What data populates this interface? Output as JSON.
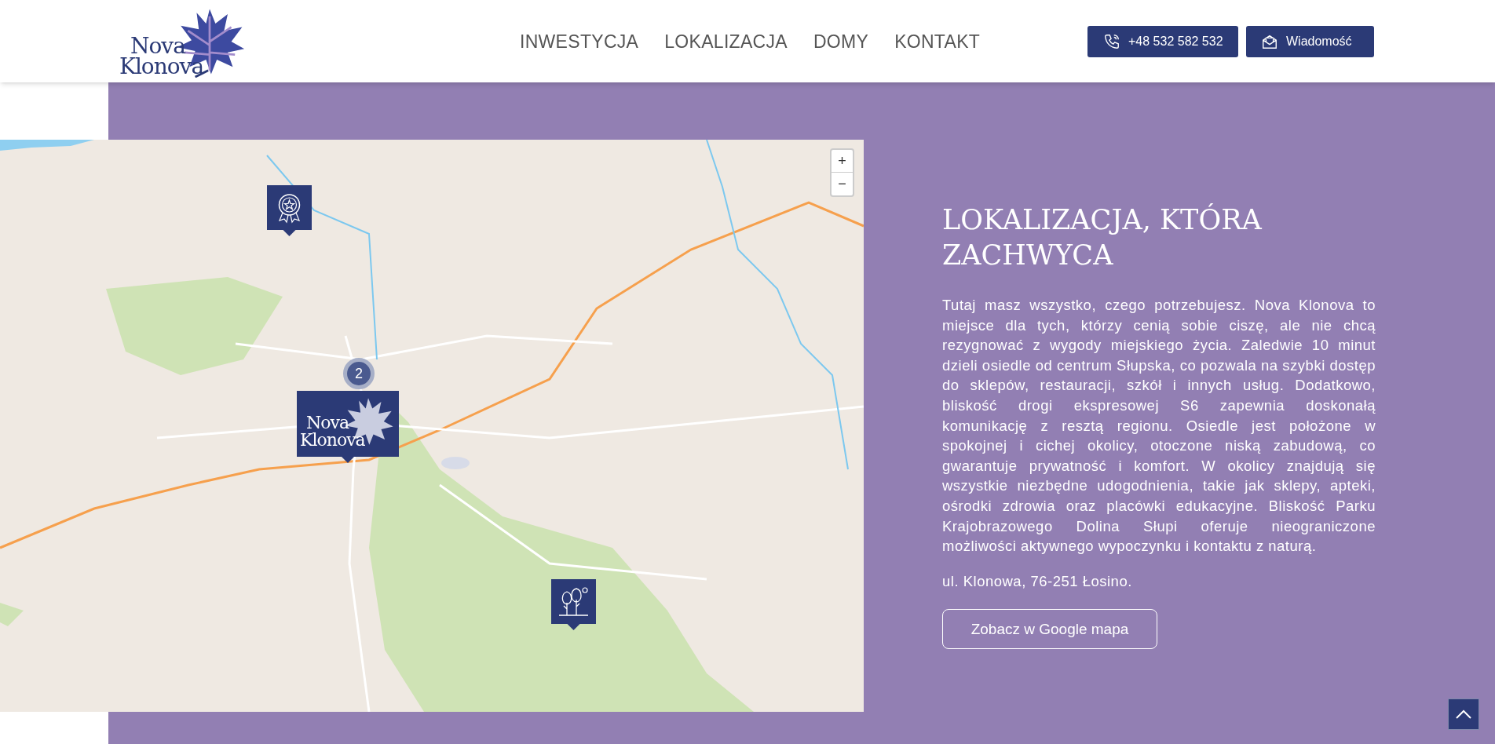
{
  "header": {
    "logo": {
      "line_1": "Nova",
      "line_2": "Klonova"
    },
    "nav": [
      {
        "label": "INWESTYCJA"
      },
      {
        "label": "LOKALIZACJA"
      },
      {
        "label": "DOMY"
      },
      {
        "label": "KONTAKT"
      }
    ],
    "buttons": [
      {
        "kind": "phone",
        "label": "+48 532 582 532"
      },
      {
        "kind": "mail",
        "label": "Wiadomość"
      }
    ]
  },
  "map": {
    "zoom_controls": [
      "+",
      "−"
    ],
    "markers": [
      {
        "kind": "award"
      },
      {
        "kind": "cluster",
        "label": "2"
      },
      {
        "kind": "logo",
        "line_1": "Nova",
        "line_2": "Klonova"
      },
      {
        "kind": "trees"
      }
    ]
  },
  "section": {
    "title": "LOKALIZACJA, KTÓRA ZACHWYCA",
    "text": "Tutaj masz wszystko, czego potrzebujesz. Nova Klonova to miejsce dla tych, którzy cenią sobie ciszę, ale nie chcą rezygnować z wygody miejskiego życia. Zaledwie 10 minut dzieli osiedle od centrum Słupska, co pozwala na szybki dostęp do sklepów, restauracji, szkół i innych usług. Dodatkowo, bliskość drogi ekspresowej S6 zapewnia doskonałą komunikację z resztą regionu. Osiedle jest położone w spokojnej i cichej okolicy, otoczone niską zabudową, co gwarantuje prywatność i komfort. W okolicy znajdują się wszystkie niezbędne udogodnienia, takie jak sklepy, apteki, ośrodki zdrowia oraz placówki edukacyjne. Bliskość Parku Krajobrazowego Dolina Słupi oferuje nieograniczone możliwości aktywnego wypoczynku i kontaktu z naturą.",
    "address": "ul. Klonowa, 76-251 Łosino.",
    "button": "Zobacz w Google mapa"
  }
}
